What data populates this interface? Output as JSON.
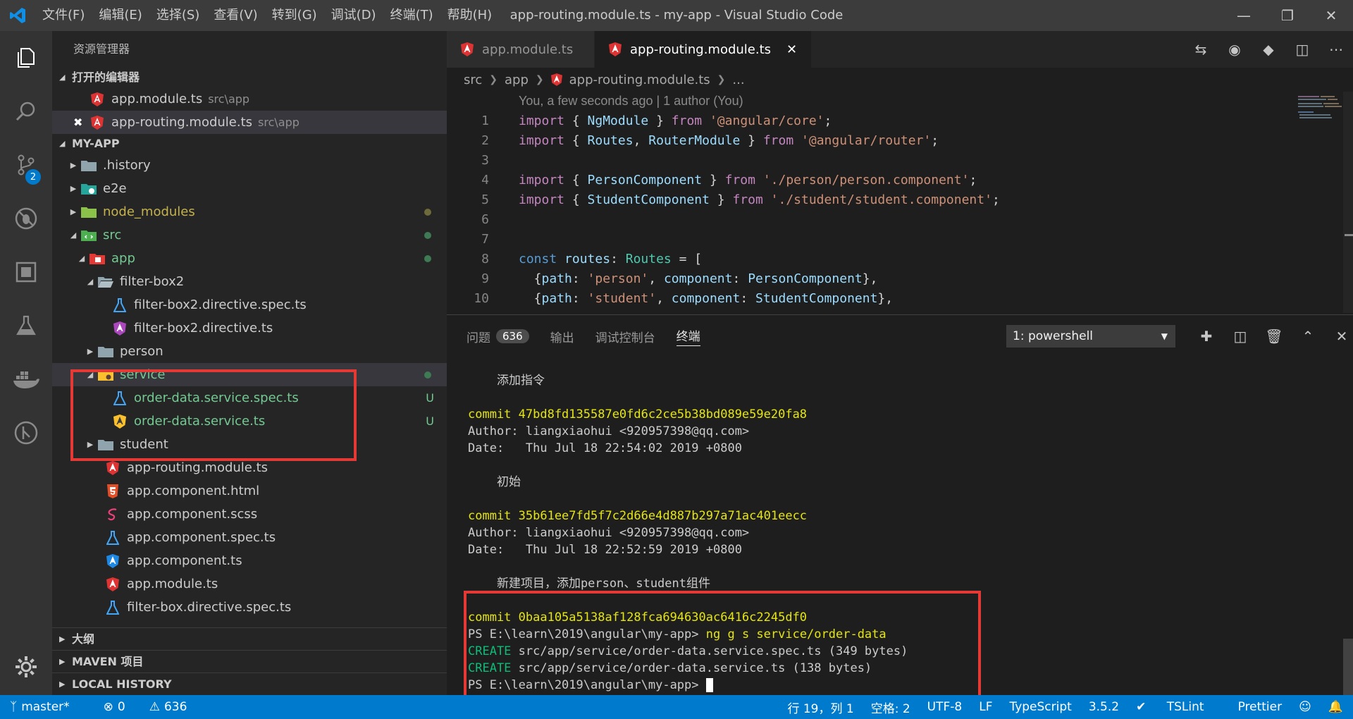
{
  "window": {
    "title": "app-routing.module.ts - my-app - Visual Studio Code",
    "menu": [
      "文件(F)",
      "编辑(E)",
      "选择(S)",
      "查看(V)",
      "转到(G)",
      "调试(D)",
      "终端(T)",
      "帮助(H)"
    ]
  },
  "activity": {
    "scm_badge": "2"
  },
  "sidebar": {
    "title": "资源管理器",
    "open_editors": {
      "header": "打开的编辑器",
      "items": [
        {
          "name": "app.module.ts",
          "path": "src\\app"
        },
        {
          "name": "app-routing.module.ts",
          "path": "src\\app"
        }
      ]
    },
    "project": {
      "header": "MY-APP",
      "tree": [
        {
          "label": ".history"
        },
        {
          "label": "e2e"
        },
        {
          "label": "node_modules"
        },
        {
          "label": "src"
        },
        {
          "label": "app"
        },
        {
          "label": "filter-box2"
        },
        {
          "label": "filter-box2.directive.spec.ts"
        },
        {
          "label": "filter-box2.directive.ts"
        },
        {
          "label": "person"
        },
        {
          "label": "service"
        },
        {
          "label": "order-data.service.spec.ts",
          "status": "U"
        },
        {
          "label": "order-data.service.ts",
          "status": "U"
        },
        {
          "label": "student"
        },
        {
          "label": "app-routing.module.ts"
        },
        {
          "label": "app.component.html"
        },
        {
          "label": "app.component.scss"
        },
        {
          "label": "app.component.spec.ts"
        },
        {
          "label": "app.component.ts"
        },
        {
          "label": "app.module.ts"
        },
        {
          "label": "filter-box.directive.spec.ts"
        }
      ]
    },
    "bottom_sections": [
      "大纲",
      "MAVEN 项目",
      "LOCAL HISTORY"
    ]
  },
  "editor": {
    "tabs": [
      {
        "label": "app.module.ts"
      },
      {
        "label": "app-routing.module.ts"
      }
    ],
    "breadcrumb": [
      "src",
      "app",
      "app-routing.module.ts",
      "..."
    ],
    "blame": "You, a few seconds ago | 1 author (You)",
    "line_numbers": [
      "1",
      "2",
      "3",
      "4",
      "5",
      "6",
      "7",
      "8",
      "9",
      "10"
    ]
  },
  "panel": {
    "tabs": [
      "问题",
      "输出",
      "调试控制台",
      "终端"
    ],
    "problems_count": "636",
    "terminal_select": "1: powershell",
    "terminal_lines": [
      "    添加指令",
      "",
      "commit 47bd8fd135587e0fd6c2ce5b38bd089e59e20fa8",
      "Author: liangxiaohui <920957398@qq.com>",
      "Date:   Thu Jul 18 22:54:02 2019 +0800",
      "",
      "    初始",
      "",
      "commit 35b61ee7fd5f7c2d66e4d887b297a71ac401eecc",
      "Author: liangxiaohui <920957398@qq.com>",
      "Date:   Thu Jul 18 22:52:59 2019 +0800",
      "",
      "    新建项目，添加person、student组件",
      "",
      "commit 0baa105a5138af128fca694630ac6416c2245df0",
      "PS E:\\learn\\2019\\angular\\my-app> ",
      "ng g s service/order-data",
      "CREATE",
      " src/app/service/order-data.service.spec.ts (349 bytes)",
      " src/app/service/order-data.service.ts (138 bytes)",
      "PS E:\\learn\\2019\\angular\\my-app> "
    ]
  },
  "statusbar": {
    "branch": "master*",
    "errors": "0",
    "warnings": "636",
    "position": "行 19，列 1",
    "spaces": "空格: 2",
    "encoding": "UTF-8",
    "eol": "LF",
    "language": "TypeScript",
    "ts_version": "3.5.2",
    "tslint": "TSLint",
    "prettier": "Prettier"
  }
}
